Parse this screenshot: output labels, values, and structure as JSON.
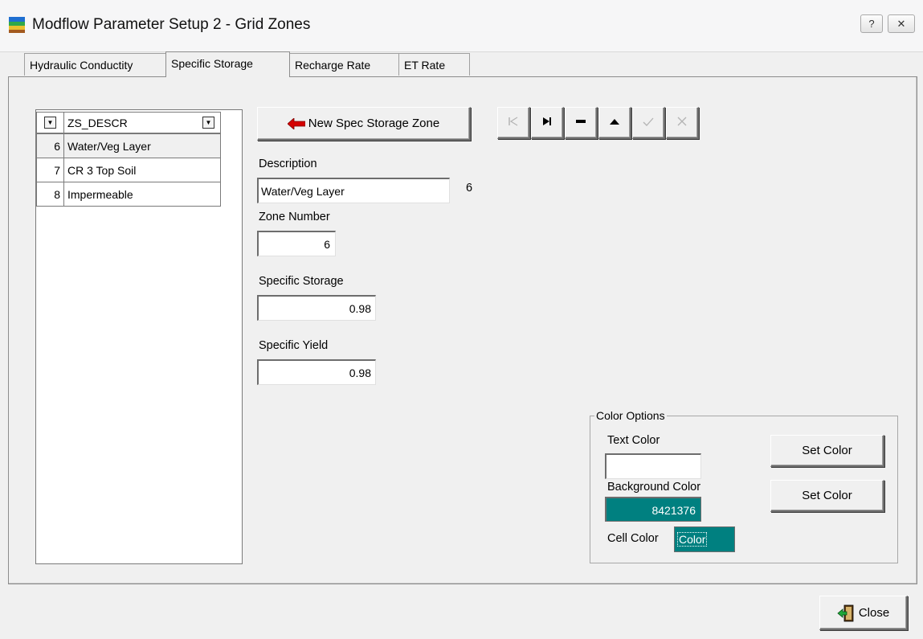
{
  "window": {
    "title": "Modflow Parameter Setup 2 - Grid Zones",
    "help_glyph": "?",
    "close_glyph": "✕"
  },
  "tabs": [
    {
      "label": "Hydraulic Conductity",
      "active": false
    },
    {
      "label": "Specific Storage",
      "active": true
    },
    {
      "label": "Recharge Rate",
      "active": false
    },
    {
      "label": "ET Rate",
      "active": false
    }
  ],
  "grid": {
    "column_header": "ZS_DESCR",
    "rows": [
      {
        "id": "6",
        "descr": "Water/Veg Layer"
      },
      {
        "id": "7",
        "descr": "CR 3 Top Soil"
      },
      {
        "id": "8",
        "descr": "Impermeable"
      }
    ]
  },
  "form": {
    "new_zone_button": "New Spec Storage Zone",
    "description_label": "Description",
    "description_value": "Water/Veg Layer",
    "description_number": "6",
    "zone_number_label": "Zone Number",
    "zone_number_value": "6",
    "specific_storage_label": "Specific Storage",
    "specific_storage_value": "0.98",
    "specific_yield_label": "Specific Yield",
    "specific_yield_value": "0.98"
  },
  "navigator": {
    "icons": [
      "first-record-icon",
      "last-record-icon",
      "delete-record-icon",
      "edit-record-icon",
      "post-record-icon",
      "cancel-record-icon"
    ]
  },
  "color_options": {
    "group_label": "Color Options",
    "text_color_label": "Text  Color",
    "text_color_value": "",
    "text_set_button": "Set Color",
    "background_color_label": "Background  Color",
    "background_color_value": "8421376",
    "background_set_button": "Set Color",
    "cell_color_label": "Cell Color",
    "cell_color_value": "Color",
    "teal": "#008080"
  },
  "footer": {
    "close_button": "Close"
  }
}
